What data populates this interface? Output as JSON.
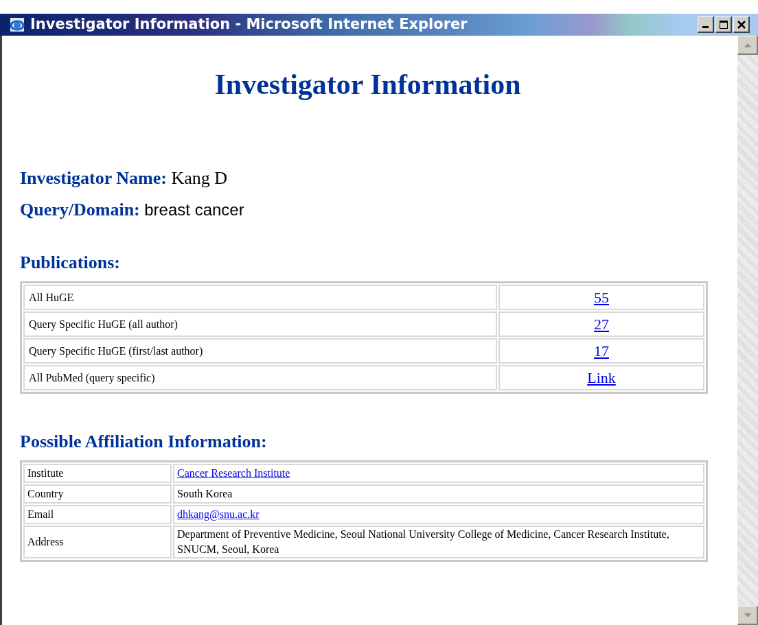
{
  "window": {
    "title": "Investigator Information - Microsoft Internet Explorer"
  },
  "page": {
    "heading": "Investigator Information",
    "fields": [
      {
        "label": "Investigator Name:",
        "value": "Kang D",
        "kind": "serif"
      },
      {
        "label": "Query/Domain:",
        "value": "breast cancer",
        "kind": "sans"
      }
    ],
    "publications": {
      "title": "Publications:",
      "rows": [
        {
          "label": "All HuGE",
          "value": "55"
        },
        {
          "label": "Query Specific HuGE (all author)",
          "value": "27"
        },
        {
          "label": "Query Specific HuGE (first/last author)",
          "value": "17"
        },
        {
          "label": "All PubMed (query specific)",
          "value": "Link"
        }
      ]
    },
    "affiliation": {
      "title": "Possible Affiliation Information:",
      "rows": [
        {
          "label": "Institute",
          "value": "Cancer Research Institute",
          "kind": "link"
        },
        {
          "label": "Country",
          "value": "South Korea",
          "kind": "text"
        },
        {
          "label": "Email",
          "value": "dhkang@snu.ac.kr",
          "kind": "link"
        },
        {
          "label": "Address",
          "value": "Department of Preventive Medicine, Seoul National University College of Medicine, Cancer Research Institute, SNUCM, Seoul, Korea",
          "kind": "text"
        }
      ]
    }
  }
}
